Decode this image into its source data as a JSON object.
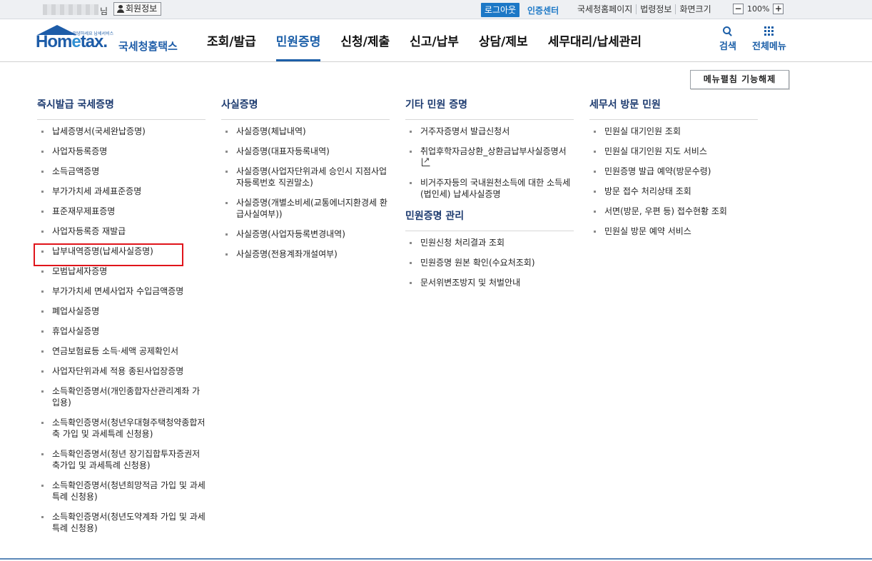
{
  "topbar": {
    "user_suffix": "님",
    "member_info": "회원정보",
    "logout": "로그아웃",
    "cert_center": "인증센터",
    "links": [
      "국세청홈페이지",
      "법령정보",
      "화면크기"
    ],
    "zoom_minus": "−",
    "zoom_level": "100%",
    "zoom_plus": "+"
  },
  "header": {
    "logo_tiny": "안녕하세요 납세서비스",
    "logo_home": "Hom",
    "logo_e": "e",
    "logo_tax": "tax.",
    "logo_kr": "국세청홈택스",
    "nav": [
      "조회/발급",
      "민원증명",
      "신청/제출",
      "신고/납부",
      "상담/제보",
      "세무대리/납세관리"
    ],
    "active_nav": "민원증명",
    "search_label": "검색",
    "all_menu_label": "전체메뉴"
  },
  "fold_button": "메뉴펼침 기능해제",
  "columns": {
    "col1": {
      "title": "즉시발급 국세증명",
      "items": [
        "납세증명서(국세완납증명)",
        "사업자등록증명",
        "소득금액증명",
        "부가가치세 과세표준증명",
        "표준재무제표증명",
        "사업자등록증 재발급",
        "납부내역증명(납세사실증명)",
        "모범납세자증명",
        "부가가치세 면세사업자 수입금액증명",
        "폐업사실증명",
        "휴업사실증명",
        "연금보험료등 소득·세액 공제확인서",
        "사업자단위과세 적용 종된사업장증명",
        "소득확인증명서(개인종합자산관리계좌 가입용)",
        "소득확인증명서(청년우대형주택청약종합저축 가입 및 과세특례 신청용)",
        "소득확인증명서(청년 장기집합투자증권저축가입 및 과세특례 신청용)",
        "소득확인증명서(청년희망적금 가입 및 과세특례 신청용)",
        "소득확인증명서(청년도약계좌 가입 및 과세특례 신청용)"
      ]
    },
    "col2": {
      "title": "사실증명",
      "items": [
        "사실증명(체납내역)",
        "사실증명(대표자등록내역)",
        "사실증명(사업자단위과세 승인시 지점사업자등록번호 직권말소)",
        "사실증명(개별소비세(교통에너지환경세 환급사실여부))",
        "사실증명(사업자등록변경내역)",
        "사실증명(전용계좌개설여부)"
      ]
    },
    "col3": {
      "title": "기타 민원 증명",
      "items": [
        "거주자증명서 발급신청서",
        "취업후학자금상환_상환금납부사실증명서",
        "비거주자등의 국내원천소득에 대한 소득세(법인세) 납세사실증명"
      ],
      "sub_title": "민원증명 관리",
      "sub_items": [
        "민원신청 처리결과 조회",
        "민원증명 원본 확인(수요처조회)",
        "문서위변조방지 및 처벌안내"
      ]
    },
    "col4": {
      "title": "세무서 방문 민원",
      "items": [
        "민원실 대기인원 조회",
        "민원실 대기인원 지도 서비스",
        "민원증명 발급 예약(방문수령)",
        "방문 접수 처리상태 조회",
        "서면(방문, 우편 등) 접수현황 조회",
        "민원실 방문 예약 서비스"
      ]
    }
  },
  "colors": {
    "brand": "#1c5fa8",
    "logout_bg": "#1c78c6",
    "highlight": "#e0141b",
    "section_title": "#1d3b70"
  }
}
